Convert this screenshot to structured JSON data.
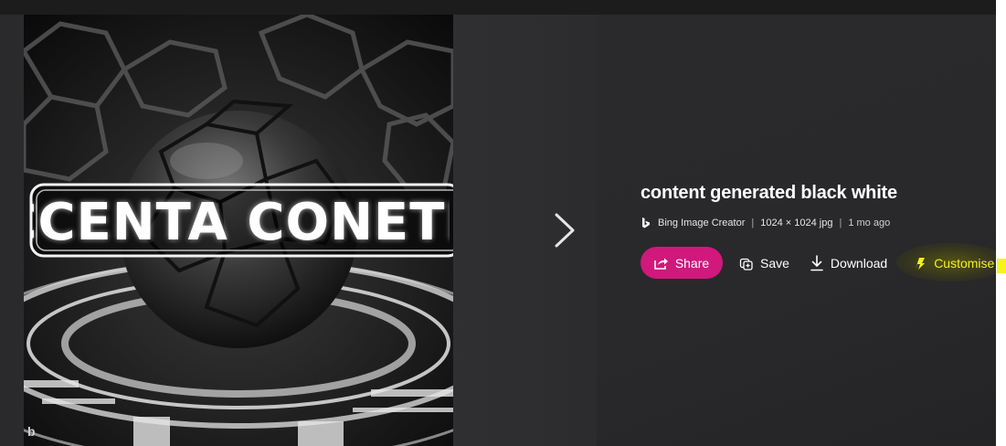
{
  "image": {
    "overlay_text": "CCENTA CONETE",
    "watermark": "b",
    "icon": "ball-image"
  },
  "navigation": {
    "next_icon": "chevron-right-icon"
  },
  "details": {
    "title": "content generated black white",
    "source_icon": "bing-logo-icon",
    "source": "Bing Image Creator",
    "separator": "|",
    "dimensions": "1024 × 1024 jpg",
    "age": "1 mo ago"
  },
  "actions": {
    "share_label": "Share",
    "save_label": "Save",
    "download_label": "Download",
    "customise_label": "Customise"
  },
  "colors": {
    "share_bg": "#d1187c",
    "highlight": "#f5f51c",
    "background": "#2a2a2c"
  }
}
